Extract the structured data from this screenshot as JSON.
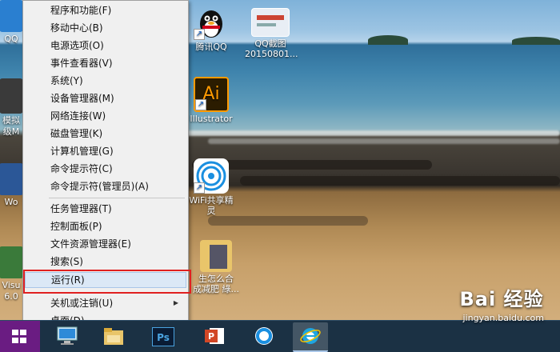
{
  "desktop": {
    "icons": {
      "qq_left": "QQ",
      "tencent_qq": "腾讯QQ",
      "qq_screenshot": "QQ截图\n20150801...",
      "illustrator": "Illustrator",
      "wifi": "WiFi共享精\n灵",
      "partial_mo": "模拟",
      "partial_ji": "级M",
      "partial_wo": "Wo",
      "partial_visu": "Visu",
      "partial_60": "6.0",
      "folder_label": "生怎么合\n成减肥 綠..."
    }
  },
  "context_menu": {
    "group1": [
      "程序和功能(F)",
      "移动中心(B)",
      "电源选项(O)",
      "事件查看器(V)",
      "系统(Y)",
      "设备管理器(M)",
      "网络连接(W)",
      "磁盘管理(K)",
      "计算机管理(G)",
      "命令提示符(C)",
      "命令提示符(管理员)(A)"
    ],
    "group2": [
      "任务管理器(T)",
      "控制面板(P)",
      "文件资源管理器(E)",
      "搜索(S)",
      "运行(R)"
    ],
    "group3": [
      "关机或注销(U)",
      "桌面(D)"
    ],
    "highlighted_item": "运行(R)",
    "submenu_arrow": "▶"
  },
  "taskbar": {
    "ps_label": "Ps"
  },
  "watermark": {
    "brand": "Bai 经验",
    "url": "jingyan.baidu.com"
  },
  "colors": {
    "highlight_box": "#e02020",
    "start_button": "#6a1c82",
    "taskbar": "#1b3144"
  }
}
